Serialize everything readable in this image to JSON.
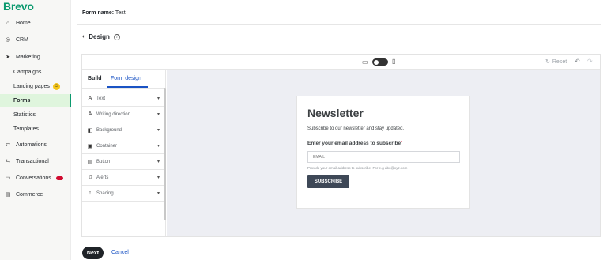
{
  "app": {
    "brand": "Brevo"
  },
  "sidebar": {
    "items": [
      {
        "label": "Home",
        "icon": "home-icon"
      },
      {
        "label": "CRM",
        "icon": "crm-icon"
      },
      {
        "label": "Marketing",
        "icon": "send-icon"
      },
      {
        "label": "Automations",
        "icon": "automation-icon"
      },
      {
        "label": "Transactional",
        "icon": "transactional-icon"
      },
      {
        "label": "Conversations",
        "icon": "chat-icon"
      },
      {
        "label": "Commerce",
        "icon": "commerce-icon"
      }
    ],
    "sub_items": [
      {
        "label": "Campaigns"
      },
      {
        "label": "Landing pages"
      },
      {
        "label": "Forms"
      },
      {
        "label": "Statistics"
      },
      {
        "label": "Templates"
      }
    ],
    "active": "Forms"
  },
  "header": {
    "form_name_label": "Form name:",
    "form_name_value": "Test"
  },
  "design": {
    "title": "Design"
  },
  "toolbar": {
    "reset_label": "Reset"
  },
  "panel": {
    "tabs": [
      {
        "label": "Build"
      },
      {
        "label": "Form design"
      }
    ],
    "active_tab": "Form design",
    "sections": [
      {
        "label": "Text",
        "icon": "text-icon"
      },
      {
        "label": "Writing direction",
        "icon": "text-direction-icon"
      },
      {
        "label": "Background",
        "icon": "background-icon"
      },
      {
        "label": "Container",
        "icon": "container-icon"
      },
      {
        "label": "Button",
        "icon": "button-icon"
      },
      {
        "label": "Alerts",
        "icon": "bell-icon"
      },
      {
        "label": "Spacing",
        "icon": "spacing-icon"
      }
    ]
  },
  "form_preview": {
    "title": "Newsletter",
    "subtitle": "Subscribe to our newsletter and stay updated.",
    "email_label": "Enter your email address to subscribe",
    "required_mark": "*",
    "email_placeholder": "EMAIL",
    "help_text": "Provide your email address to subscribe. For e.g abc@xyz.com",
    "button_label": "SUBSCRIBE"
  },
  "footer": {
    "next_label": "Next",
    "cancel_label": "Cancel"
  },
  "colors": {
    "brand": "#0b996e",
    "accent": "#1a53c4",
    "active_nav_bg": "#dff5dd",
    "subscribe_button": "#3e4857"
  }
}
